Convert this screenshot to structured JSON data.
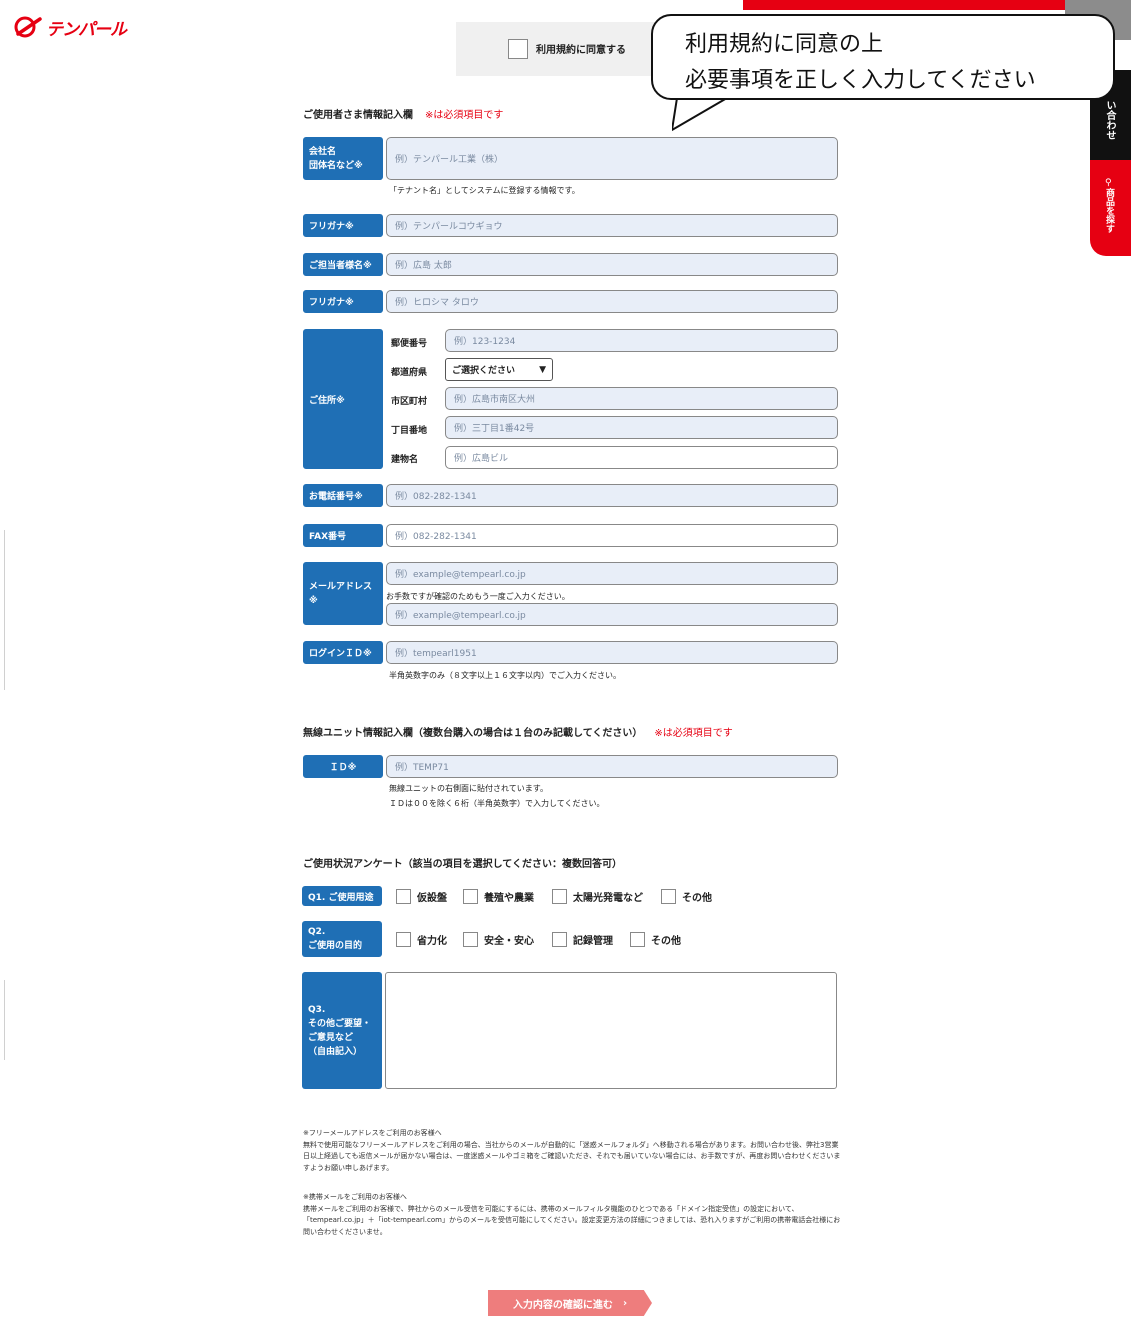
{
  "brand": {
    "name": "テンパール",
    "color": "#e60012"
  },
  "header": {
    "agree_label": "利用規約に同意する",
    "side_contact": "い合わせ",
    "side_search": "商品を探す"
  },
  "bubble": {
    "line1": "利用規約に同意の上",
    "line2": "必要事項を正しく入力してください"
  },
  "user_section": {
    "title": "ご使用者さま情報記入欄",
    "required_note": "※は必須項目です",
    "company": {
      "label1": "会社名",
      "label2": "団体名など※",
      "placeholder": "例）テンパール工業（株）",
      "note": "「テナント名」としてシステムに登録する情報です。"
    },
    "company_kana": {
      "label": "フリガナ※",
      "placeholder": "例）テンパールコウギョウ"
    },
    "person": {
      "label": "ご担当者様名※",
      "placeholder": "例）広島 太郎"
    },
    "person_kana": {
      "label": "フリガナ※",
      "placeholder": "例）ヒロシマ タロウ"
    },
    "address": {
      "label": "ご住所※",
      "postal": {
        "label": "郵便番号",
        "placeholder": "例）123-1234"
      },
      "prefecture": {
        "label": "都道府県",
        "value": "ご選択ください"
      },
      "city": {
        "label": "市区町村",
        "placeholder": "例）広島市南区大州"
      },
      "street": {
        "label": "丁目番地",
        "placeholder": "例）三丁目1番42号"
      },
      "building": {
        "label": "建物名",
        "placeholder": "例）広島ビル"
      }
    },
    "phone": {
      "label": "お電話番号※",
      "placeholder": "例）082-282-1341"
    },
    "fax": {
      "label": "FAX番号",
      "placeholder": "例）082-282-1341"
    },
    "email": {
      "label1": "メールアドレス",
      "label2": "※",
      "placeholder": "例）example@tempearl.co.jp",
      "confirm_note": "お手数ですが確認のためもう一度ご入力ください。",
      "confirm_placeholder": "例）example@tempearl.co.jp"
    },
    "login": {
      "label": "ログインＩＤ※",
      "placeholder": "例）tempearl1951",
      "note": "半角英数字のみ（８文字以上１６文字以内）でご入力ください。"
    }
  },
  "unit_section": {
    "title": "無線ユニット情報記入欄（複数台購入の場合は１台のみ記載してください）",
    "required_note": "※は必須項目です",
    "id": {
      "label": "ＩＤ※",
      "placeholder": "例）TEMP71",
      "note1": "無線ユニットの右側面に貼付されています。",
      "note2": "ＩＤは００を除く６桁（半角英数字）で入力してください。"
    }
  },
  "survey": {
    "title": "ご使用状況アンケート（該当の項目を選択してください：複数回答可）",
    "q1": {
      "label": "Q1. ご使用用途",
      "options": [
        "仮設盤",
        "養殖や農業",
        "太陽光発電など",
        "その他"
      ]
    },
    "q2": {
      "label1": "Q2.",
      "label2": "ご使用の目的",
      "options": [
        "省力化",
        "安全・安心",
        "記録管理",
        "その他"
      ]
    },
    "q3": {
      "label1": "Q3.",
      "label2": "その他ご要望・",
      "label3": "ご意見など",
      "label4": "（自由記入）"
    }
  },
  "notes": {
    "free_title": "※フリーメールアドレスをご利用のお客様へ",
    "free_body": "無料で使用可能なフリーメールアドレスをご利用の場合、当社からのメールが自動的に「迷惑メールフォルダ」へ移動される場合があります。お問い合わせ後、弊社3営業日以上経過しても返信メールが届かない場合は、一度迷惑メールやゴミ箱をご確認いただき、それでも届いていない場合には、お手数ですが、再度お問い合わせくださいますようお願い申しあげます。",
    "mobile_title": "※携帯メールをご利用のお客様へ",
    "mobile_body": "携帯メールをご利用のお客様で、弊社からのメール受信を可能にするには、携帯のメールフィルタ機能のひとつである「ドメイン指定受信」の設定において、「tempearl.co.jp」＋「iot-tempearl.com」からのメールを受信可能にしてください。設定変更方法の詳細につきましては、恐れ入りますがご利用の携帯電話会社様にお問い合わせくださいませ。"
  },
  "submit": {
    "label": "入力内容の確認に進む",
    "arrow": "›"
  }
}
